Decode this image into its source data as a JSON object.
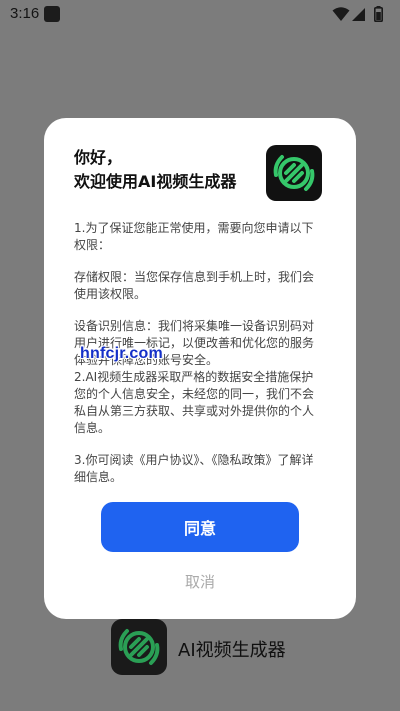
{
  "status_bar": {
    "time": "3:16",
    "icons": [
      "notification-icon",
      "wifi-icon",
      "signal-icon",
      "battery-icon"
    ]
  },
  "dialog": {
    "greeting_line1": "你好，",
    "greeting_line2": "欢迎使用AI视频生成器",
    "paragraphs": [
      "1.为了保证您能正常使用，需要向您申请以下权限：",
      "存储权限：当您保存信息到手机上时，我们会使用该权限。",
      "设备识别信息：我们将采集唯一设备识别码对用户进行唯一标记，以便改善和优化您的服务体验并保障您的账号安全。",
      "2.AI视频生成器采取严格的数据安全措施保护您的个人信息安全，未经您的同一，我们不会私自从第三方获取、共享或对外提供你的个人信息。",
      "3.你可阅读《用户协议》、《隐私政策》了解详细信息。"
    ],
    "agree_label": "同意",
    "cancel_label": "取消"
  },
  "splash": {
    "app_name": "AI视频生成器"
  },
  "watermark": "hnfcjr.com",
  "colors": {
    "accent": "#1f63f0",
    "overlay": "#7c7c7c",
    "logo_green": "#35c76a"
  }
}
